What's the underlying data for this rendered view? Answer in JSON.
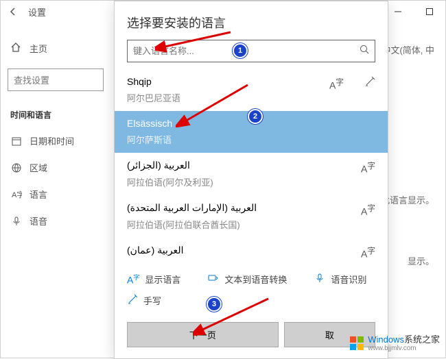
{
  "titlebar": {
    "title": "设置"
  },
  "sidebar": {
    "home": "主页",
    "search_placeholder": "查找设置",
    "section": "时间和语言",
    "items": [
      {
        "label": "日期和时间"
      },
      {
        "label": "区域"
      },
      {
        "label": "语言"
      },
      {
        "label": "语音"
      }
    ]
  },
  "content": {
    "lang_current": "中文(简体, 中",
    "desc1": "使用此语言显示。",
    "desc2": "显示。"
  },
  "dialog": {
    "title": "选择要安装的语言",
    "search_placeholder": "键入语言名称...",
    "languages": [
      {
        "name": "Shqip",
        "sub": "阿尔巴尼亚语"
      },
      {
        "name": "Elsässisch",
        "sub": "阿尔萨斯语",
        "selected": true
      },
      {
        "name": "العربية (الجزائر)",
        "sub": "阿拉伯语(阿尔及利亚)"
      },
      {
        "name": "العربية (الإمارات العربية المتحدة)",
        "sub": "阿拉伯语(阿拉伯联合酋长国)"
      },
      {
        "name": "العربية (عمان)",
        "sub": "阿拉伯语(阿曼)"
      }
    ],
    "features": [
      {
        "icon": "A字",
        "label": "显示语言"
      },
      {
        "icon": "tts",
        "label": "文本到语音转换"
      },
      {
        "icon": "mic",
        "label": "语音识别"
      },
      {
        "icon": "pen",
        "label": "手写"
      }
    ],
    "next": "下一页",
    "cancel": "取"
  },
  "annotations": {
    "n1": "1",
    "n2": "2",
    "n3": "3"
  },
  "watermark": {
    "brand": "Windows",
    "suffix": "系统之家",
    "url": "www.bjjmlv.com"
  }
}
